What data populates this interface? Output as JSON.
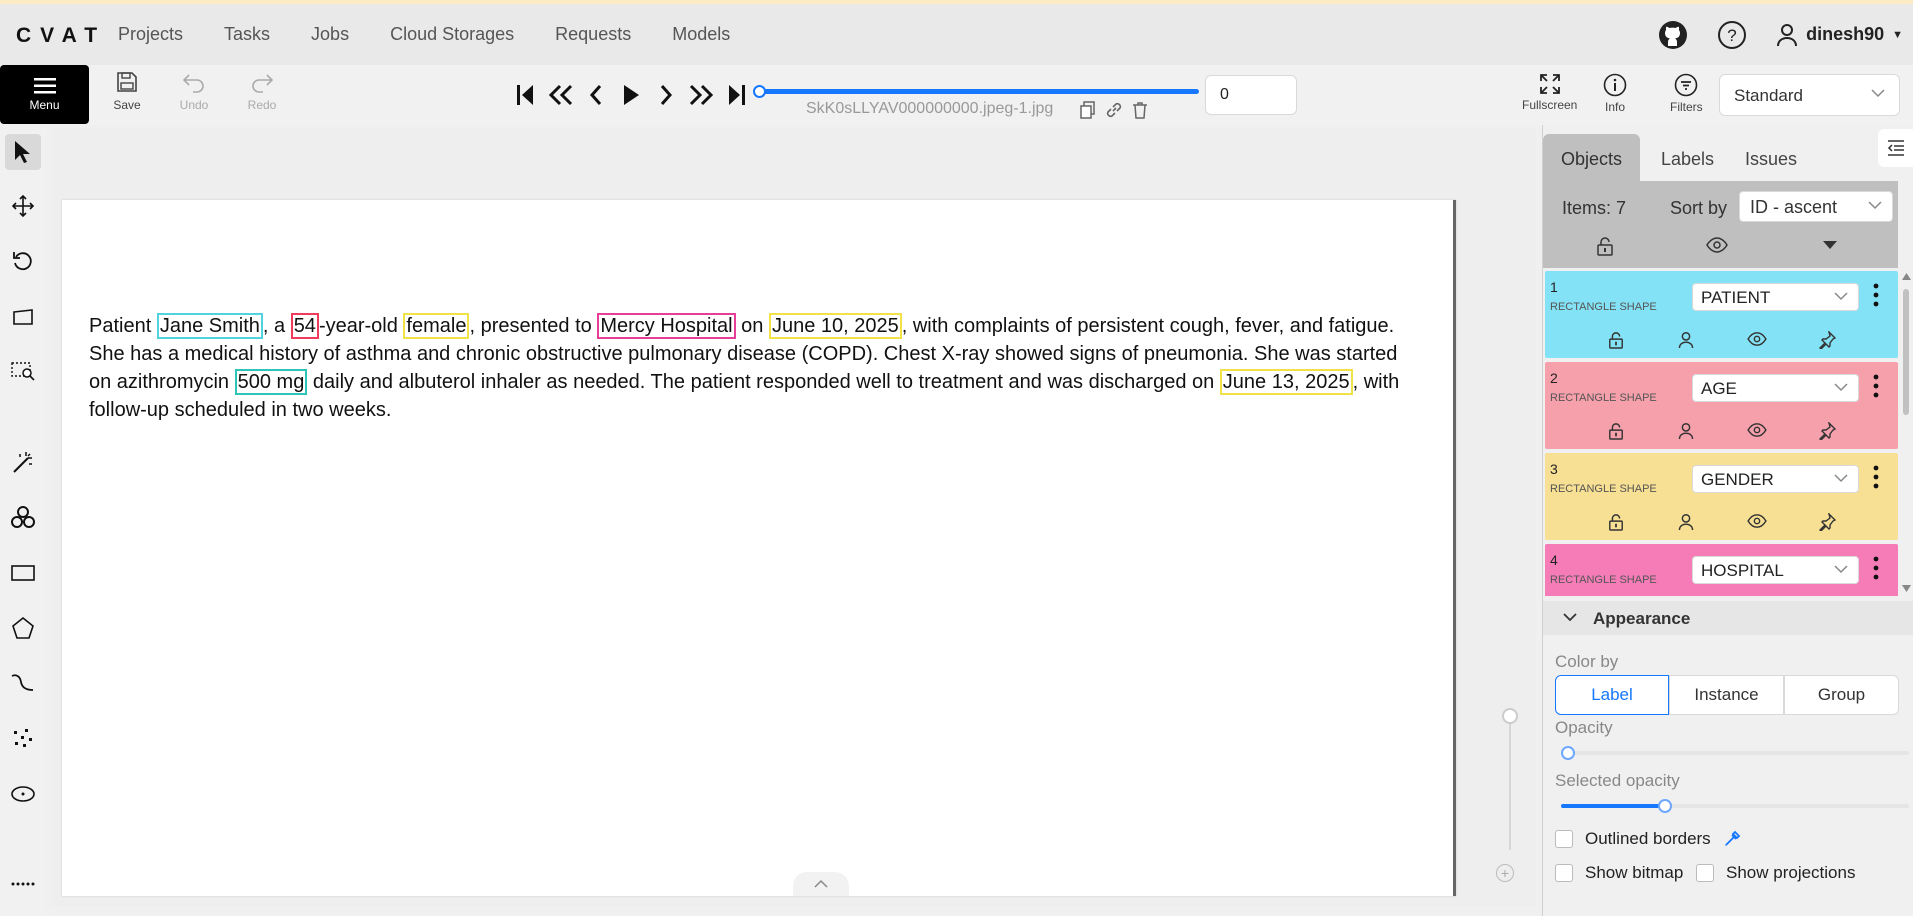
{
  "app": {
    "logo": "CVAT"
  },
  "nav": [
    "Projects",
    "Tasks",
    "Jobs",
    "Cloud Storages",
    "Requests",
    "Models"
  ],
  "user": {
    "name": "dinesh90"
  },
  "toolbar": {
    "menu": "Menu",
    "save": "Save",
    "undo": "Undo",
    "redo": "Redo",
    "filename": "SkK0sLLYAV000000000.jpeg-1.jpg",
    "frame": "0",
    "frame_progress": 0,
    "fullscreen": "Fullscreen",
    "info": "Info",
    "filters": "Filters",
    "workspace": "Standard"
  },
  "document": {
    "segments": [
      {
        "t": "Patient "
      },
      {
        "t": "Jane Smith",
        "hl": "cyan"
      },
      {
        "t": ", a "
      },
      {
        "t": "54",
        "hl": "red"
      },
      {
        "t": "-year-old "
      },
      {
        "t": "female",
        "hl": "yellow"
      },
      {
        "t": ", presented to "
      },
      {
        "t": "Mercy Hospital",
        "hl": "pink"
      },
      {
        "t": " on "
      },
      {
        "t": "June 10, 2025",
        "hl": "yellow"
      },
      {
        "t": ", with complaints of persistent cough, fever, and fatigue. She has a medical history of asthma and chronic obstructive pulmonary disease (COPD). Chest X-ray showed signs of pneumonia. She was started on azithromycin "
      },
      {
        "t": "500 mg",
        "hl": "teal"
      },
      {
        "t": " daily and albuterol inhaler as needed. The patient responded well to treatment and was discharged on "
      },
      {
        "t": "June 13, 2025",
        "hl": "yellow"
      },
      {
        "t": ", with follow-up scheduled in two weeks."
      }
    ]
  },
  "sidebar": {
    "tabs": [
      "Objects",
      "Labels",
      "Issues"
    ],
    "items_count": "Items: 7",
    "sort_label": "Sort by",
    "sort_value": "ID - ascent",
    "objects": [
      {
        "id": "1",
        "shape": "RECTANGLE SHAPE",
        "label": "PATIENT",
        "color": "#83e2f5"
      },
      {
        "id": "2",
        "shape": "RECTANGLE SHAPE",
        "label": "AGE",
        "color": "#f6a0ac"
      },
      {
        "id": "3",
        "shape": "RECTANGLE SHAPE",
        "label": "GENDER",
        "color": "#f7df93"
      },
      {
        "id": "4",
        "shape": "RECTANGLE SHAPE",
        "label": "HOSPITAL",
        "color": "#f57cb7"
      }
    ],
    "appearance": {
      "title": "Appearance",
      "color_by": "Color by",
      "color_options": [
        "Label",
        "Instance",
        "Group"
      ],
      "selected_color": "Label",
      "opacity_label": "Opacity",
      "opacity": 0,
      "selected_opacity_label": "Selected opacity",
      "selected_opacity": 0.3,
      "outlined_borders": "Outlined borders",
      "show_bitmap": "Show bitmap",
      "show_projections": "Show projections"
    }
  },
  "colors": {
    "accent": "#1677ff"
  }
}
